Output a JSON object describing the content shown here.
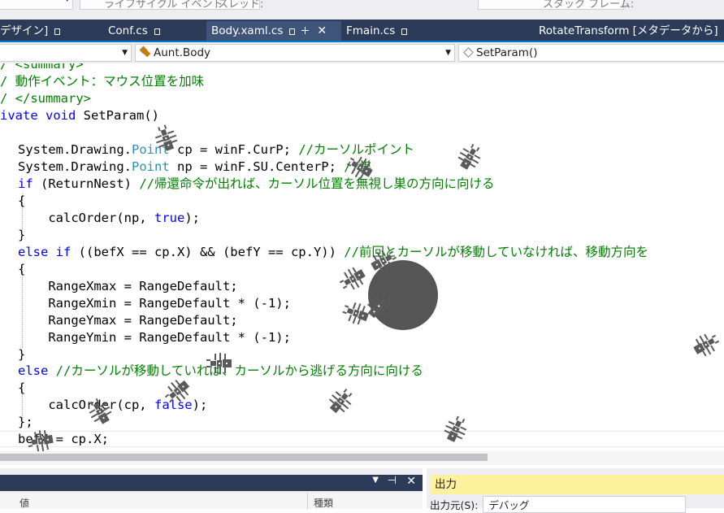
{
  "toolbar": {
    "item1": "ライフサイクル イベント",
    "item2": "スレッド:",
    "item3": "スタック フレーム:"
  },
  "tabs": [
    {
      "label": "デザイン]"
    },
    {
      "label": "Conf.cs"
    },
    {
      "label": "Body.xaml.cs"
    },
    {
      "label": "Fmain.cs"
    },
    {
      "label": "RotateTransform [メタデータから]"
    }
  ],
  "nav": {
    "class_combo": "Aunt.Body",
    "member_combo": "SetParam()"
  },
  "code": {
    "l1": "/ <summary>",
    "l2": "/ 動作イベント：マウス位置を加味",
    "l3": "/ </summary>",
    "l4_kw": "ivate void",
    "l4_rest": " SetParam()",
    "l5": "",
    "l6_a": "System.Drawing.",
    "l6_ty": "Point",
    "l6_b": " cp = winF.CurP; ",
    "l6_cm": "//カーソルポイント",
    "l7_a": "System.Drawing.",
    "l7_ty": "Point",
    "l7_b": " np = winF.SU.CenterP; ",
    "l7_cm": "//巣",
    "l8_kw": "if",
    "l8_b": " (ReturnNest) ",
    "l8_cm": "//帰還命令が出れば、カーソル位置を無視し巣の方向に向ける",
    "l9": "{",
    "l10_a": "    calcOrder(np, ",
    "l10_kw": "true",
    "l10_b": ");",
    "l11": "}",
    "l12_kw1": "else",
    "l12_kw2": " if",
    "l12_b": " ((befX == cp.X) && (befY == cp.Y)) ",
    "l12_cm": "//前回とカーソルが移動していなければ、移動方向を",
    "l13": "{",
    "l14": "    RangeXmax = RangeDefault;",
    "l15": "    RangeXmin = RangeDefault * (-1);",
    "l16": "    RangeYmax = RangeDefault;",
    "l17": "    RangeYmin = RangeDefault * (-1);",
    "l18": "}",
    "l19_kw": "else",
    "l19_cm": " //カーソルが移動していれば、カーソルから逃げる方向に向ける",
    "l20": "{",
    "l21_a": "    calcOrder(cp, ",
    "l21_kw": "false",
    "l21_b": ");",
    "l22": "};",
    "l23": "befX = cp.X;"
  },
  "bottom": {
    "left_col1": "値",
    "left_col2": "種類",
    "output_title": "出力",
    "output_source_label": "出力元(S):",
    "output_source_value": "デバッグ"
  },
  "colors": {
    "tabbar": "#2b3b58",
    "comment": "#008000",
    "keyword": "#0000ff",
    "type": "#2b91af",
    "output_header": "#fff29d"
  }
}
